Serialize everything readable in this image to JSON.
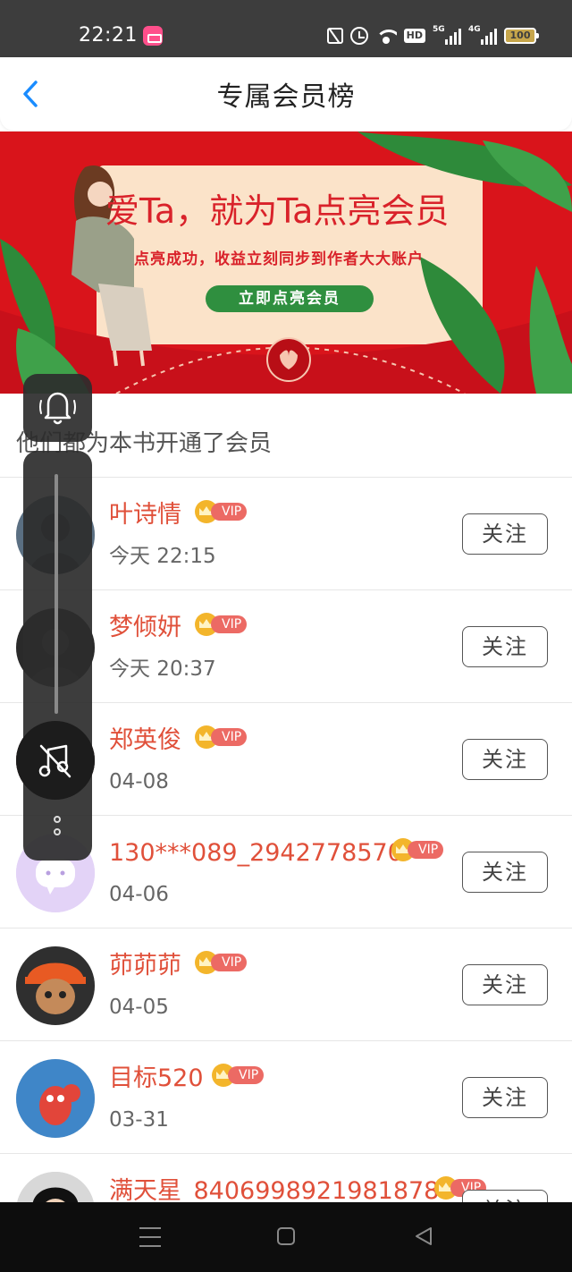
{
  "status_bar": {
    "time": "22:21",
    "network_badge": "HD",
    "signal_5g": "5G",
    "signal_4g": "4G",
    "battery": "100"
  },
  "header": {
    "back_icon": "chevron-left-icon",
    "title": "专属会员榜"
  },
  "banner": {
    "title": "爱Ta，就为Ta点亮会员",
    "subtitle": "点亮成功，收益立刻同步到作者大大账户",
    "button_label": "立即点亮会员",
    "colors": {
      "background": "#d9141b",
      "card": "#fbe3c9",
      "accent_green": "#2f8f3f"
    }
  },
  "section": {
    "title": "他们都为本书开通了会员"
  },
  "members": [
    {
      "name": "叶诗情",
      "badge": "VIP",
      "time": "今天 22:15",
      "follow_label": "关注"
    },
    {
      "name": "梦倾妍",
      "badge": "VIP",
      "time": "今天 20:37",
      "follow_label": "关注"
    },
    {
      "name": "郑英俊",
      "badge": "VIP",
      "time": "04-08",
      "follow_label": "关注"
    },
    {
      "name": "130***089_2942778570",
      "badge": "VIP",
      "time": "04-06",
      "follow_label": "关注"
    },
    {
      "name": "茆茆茆",
      "badge": "VIP",
      "time": "04-05",
      "follow_label": "关注"
    },
    {
      "name": "目标520",
      "badge": "VIP",
      "time": "03-31",
      "follow_label": "关注"
    },
    {
      "name": "满天星_8406998921981878",
      "badge": "VIP",
      "time": "",
      "follow_label": "关注"
    }
  ],
  "colors": {
    "name_red": "#e0503a",
    "vip_tag": "#ec6a64",
    "crown_gold": "#f3b52b",
    "back_blue": "#1a8cff"
  }
}
